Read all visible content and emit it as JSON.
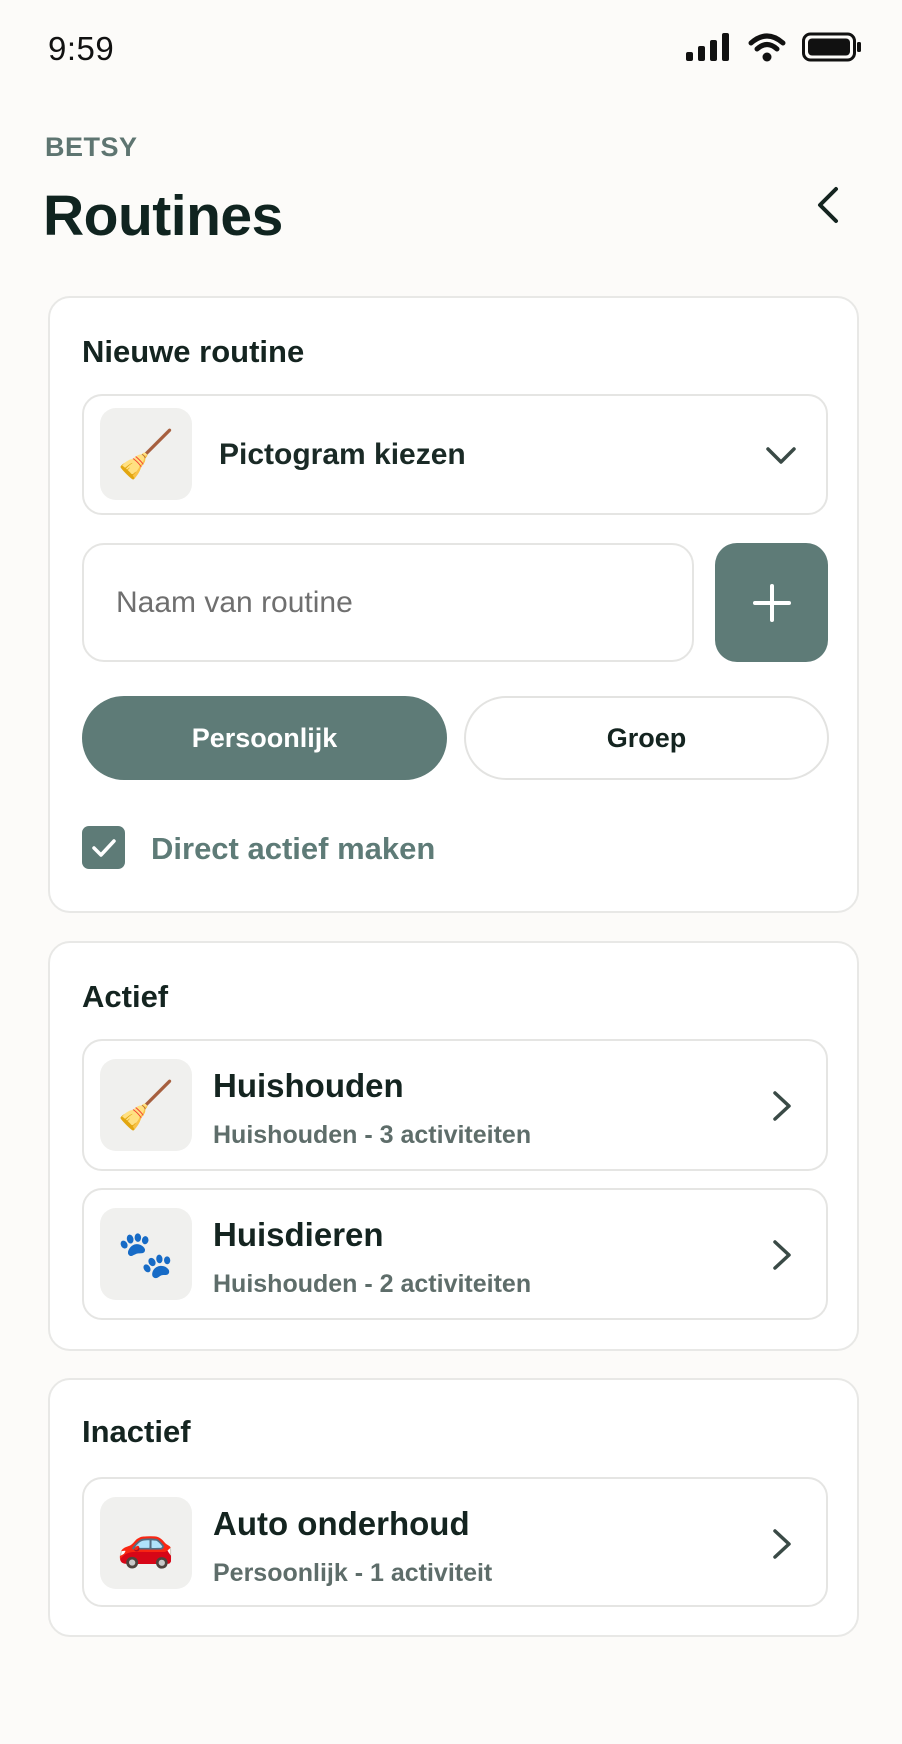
{
  "status_bar": {
    "time": "9:59"
  },
  "header": {
    "owner": "BETSY",
    "title": "Routines"
  },
  "new_routine": {
    "title": "Nieuwe routine",
    "icon_picker": {
      "icon": "broom-icon",
      "emoji": "🧹",
      "label": "Pictogram kiezen"
    },
    "name_input": {
      "value": "",
      "placeholder": "Naam van routine"
    },
    "type_options": [
      {
        "label": "Persoonlijk",
        "selected": true
      },
      {
        "label": "Groep",
        "selected": false
      }
    ],
    "activate_now": {
      "label": "Direct actief maken",
      "checked": true
    }
  },
  "active": {
    "title": "Actief",
    "routines": [
      {
        "icon": "broom-icon",
        "emoji": "🧹",
        "name": "Huishouden",
        "meta": "Huishouden - 3 activiteiten"
      },
      {
        "icon": "paw-prints-icon",
        "emoji": "🐾",
        "name": "Huisdieren",
        "meta": "Huishouden - 2 activiteiten"
      }
    ]
  },
  "inactive": {
    "title": "Inactief",
    "routines": [
      {
        "icon": "car-icon",
        "emoji": "🚗",
        "name": "Auto onderhoud",
        "meta": "Persoonlijk - 1 activiteit"
      }
    ]
  },
  "colors": {
    "accent": "#5e7b77",
    "title": "#102420",
    "muted": "#5e7571",
    "background": "#fcfbf9",
    "card": "#ffffff"
  }
}
